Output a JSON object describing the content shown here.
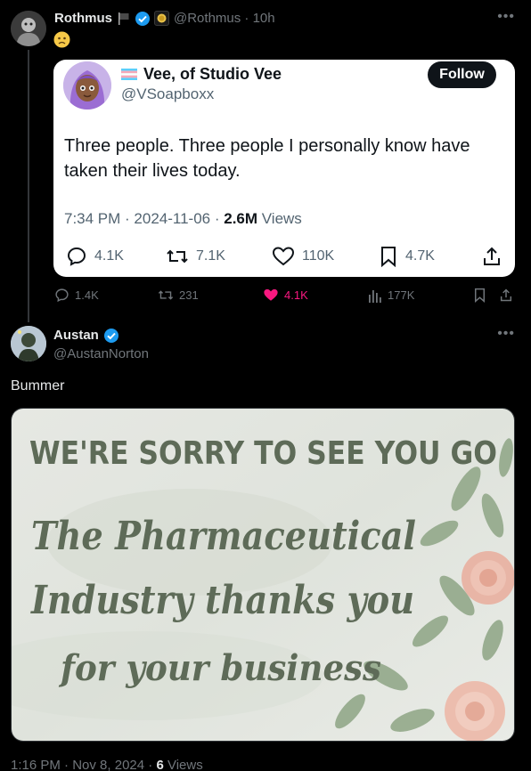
{
  "tweet1": {
    "name": "Rothmus",
    "handle": "@Rothmus",
    "time": "10h",
    "emoji_icon": "slightly-frowning-face-emoji",
    "actions": {
      "replies": "1.4K",
      "reposts": "231",
      "likes": "4.1K",
      "views": "177K"
    }
  },
  "quote": {
    "name": "Vee, of Studio Vee",
    "handle": "@VSoapboxx",
    "follow_label": "Follow",
    "text": "Three people. Three people I personally know have taken their lives today.",
    "time": "7:34 PM",
    "date": "2024-11-06",
    "views_count": "2.6M",
    "views_label": "Views",
    "actions": {
      "replies": "4.1K",
      "reposts": "7.1K",
      "likes": "110K",
      "bookmarks": "4.7K"
    }
  },
  "tweet2": {
    "name": "Austan",
    "handle": "@AustanNorton",
    "text": "Bummer",
    "image": {
      "headline": "WE'RE SORRY TO SEE YOU GO",
      "line1": "The Pharmaceutical",
      "line2": "Industry thanks you",
      "line3": "for your business"
    },
    "time": "1:16 PM",
    "date": "Nov 8, 2024",
    "views_count": "6",
    "views_label": "Views"
  },
  "colors": {
    "background": "#000000",
    "text": "#e7e9ea",
    "muted": "#71767b",
    "verified": "#1d9bf0",
    "like_active": "#f91880",
    "card_text": "#5e6b58"
  }
}
